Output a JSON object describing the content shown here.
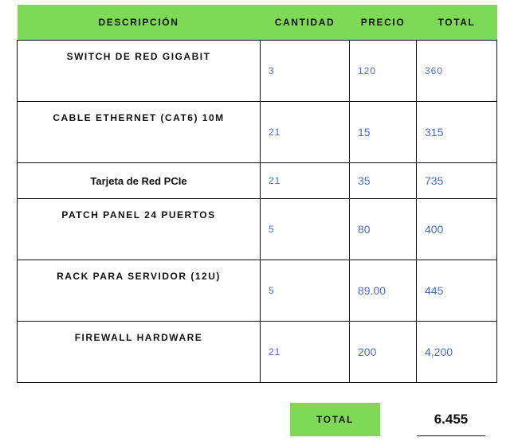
{
  "header": {
    "description": "DESCRIPCIÓN",
    "quantity": "CANTIDAD",
    "price": "PRECIO",
    "total": "TOTAL"
  },
  "rows": [
    {
      "description": "SWITCH DE RED GIGABIT",
      "quantity": "3",
      "price": "120",
      "total": "360"
    },
    {
      "description": "CABLE ETHERNET (CAT6) 10M",
      "quantity": "21",
      "price": "15",
      "total": "315"
    },
    {
      "description": "Tarjeta de Red PCIe",
      "quantity": "21",
      "price": "35",
      "total": "735"
    },
    {
      "description": "PATCH PANEL 24 PUERTOS",
      "quantity": "5",
      "price": "80",
      "total": "400"
    },
    {
      "description": "RACK PARA SERVIDOR (12U)",
      "quantity": "5",
      "price": "89.00",
      "total": "445"
    },
    {
      "description": "FIREWALL HARDWARE",
      "quantity": "21",
      "price": "200",
      "total": "4,200"
    }
  ],
  "summary": {
    "label": "TOTAL",
    "value": "6.455"
  },
  "colors": {
    "header_bg": "#7ed957",
    "number_text": "#4a6ad0",
    "border": "#111111"
  }
}
